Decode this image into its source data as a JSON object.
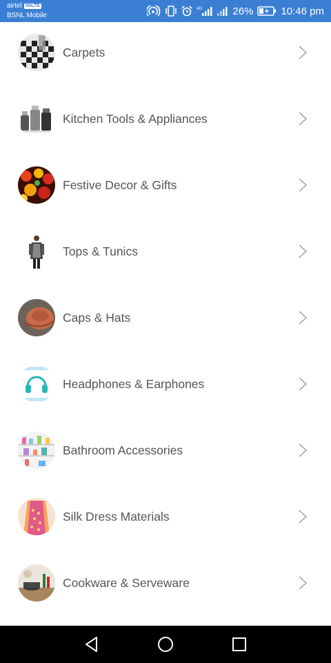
{
  "status_bar": {
    "carrier_primary": "airtel",
    "volte_badge": "VoLTE",
    "carrier_secondary": "BSNL Mobile",
    "network_type": "4G",
    "battery_percent": "26%",
    "time": "10:46 pm",
    "icons": [
      "hotspot-icon",
      "vibrate-icon",
      "alarm-icon",
      "signal-icon",
      "signal-icon",
      "battery-icon"
    ]
  },
  "categories": [
    {
      "label": "Carpets",
      "icon": "carpet-thumbnail"
    },
    {
      "label": "Kitchen Tools & Appliances",
      "icon": "kitchen-appliances-thumbnail"
    },
    {
      "label": "Festive Decor & Gifts",
      "icon": "festive-decor-thumbnail"
    },
    {
      "label": "Tops & Tunics",
      "icon": "tunic-thumbnail"
    },
    {
      "label": "Caps & Hats",
      "icon": "hat-thumbnail"
    },
    {
      "label": "Headphones & Earphones",
      "icon": "headphones-thumbnail"
    },
    {
      "label": "Bathroom Accessories",
      "icon": "bathroom-accessories-thumbnail"
    },
    {
      "label": "Silk Dress Materials",
      "icon": "silk-fabric-thumbnail"
    },
    {
      "label": "Cookware & Serveware",
      "icon": "cookware-thumbnail"
    }
  ],
  "nav_bar": {
    "buttons": [
      "back-icon",
      "home-icon",
      "recents-icon"
    ]
  },
  "colors": {
    "status_bar": "#3b7fd4",
    "label_text": "#555555",
    "chevron": "#9e9e9e",
    "nav_bar": "#000000"
  }
}
